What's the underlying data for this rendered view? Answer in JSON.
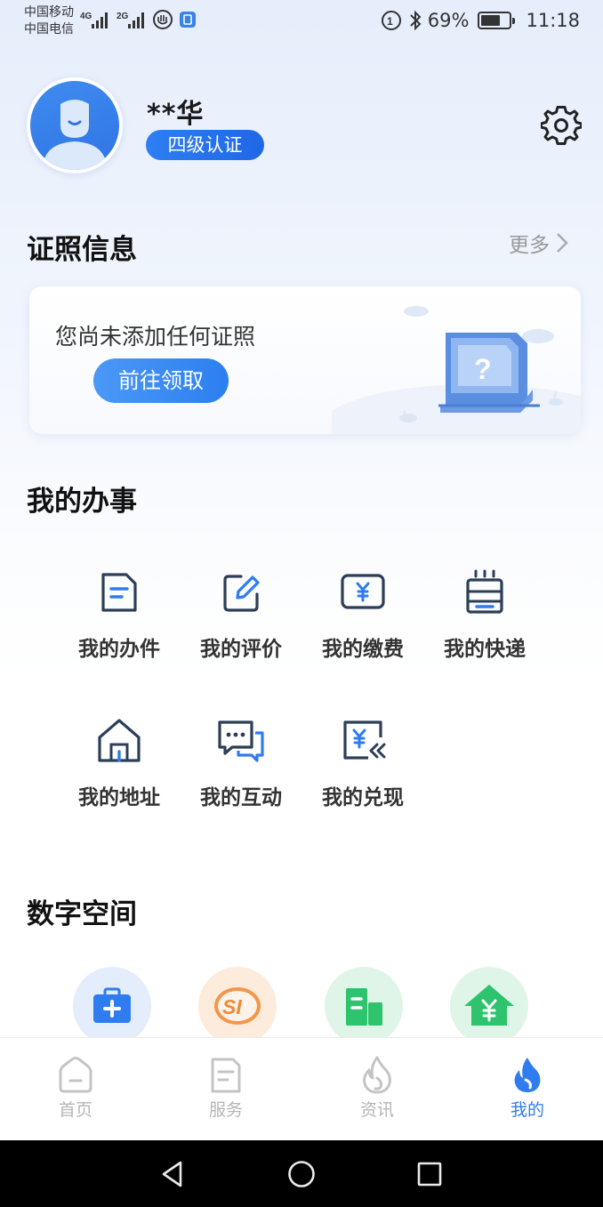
{
  "status_bar": {
    "carrier_1": "中国移动",
    "carrier_2": "中国电信",
    "net_1": "4G",
    "net_2": "2G",
    "battery_percent": "69%",
    "battery_level": 0.69,
    "time": "11:18"
  },
  "profile": {
    "username": "**华",
    "auth_level": "四级认证"
  },
  "license_section": {
    "title": "证照信息",
    "more_label": "更多",
    "empty_text": "您尚未添加任何证照",
    "claim_button": "前往领取"
  },
  "affairs_section": {
    "title": "我的办事",
    "items": [
      {
        "label": "我的办件",
        "icon": "document-icon"
      },
      {
        "label": "我的评价",
        "icon": "edit-icon"
      },
      {
        "label": "我的缴费",
        "icon": "payment-icon"
      },
      {
        "label": "我的快递",
        "icon": "package-icon"
      },
      {
        "label": "我的地址",
        "icon": "home-icon"
      },
      {
        "label": "我的互动",
        "icon": "chat-icon"
      },
      {
        "label": "我的兑现",
        "icon": "redeem-icon"
      }
    ]
  },
  "digital_section": {
    "title": "数字空间",
    "items": [
      {
        "icon": "medical-kit-icon",
        "bg": "#e3edfb",
        "fg": "#2f7cf0"
      },
      {
        "icon": "social-security-icon",
        "bg": "#fdebdc",
        "fg": "#f08a34"
      },
      {
        "icon": "building-icon",
        "bg": "#dff5e7",
        "fg": "#27c06a"
      },
      {
        "icon": "housing-fund-icon",
        "bg": "#dff5e7",
        "fg": "#27c06a"
      }
    ]
  },
  "bottom_nav": {
    "items": [
      {
        "label": "首页",
        "icon": "home-tab-icon"
      },
      {
        "label": "服务",
        "icon": "service-tab-icon"
      },
      {
        "label": "资讯",
        "icon": "news-tab-icon"
      },
      {
        "label": "我的",
        "icon": "mine-tab-icon"
      }
    ],
    "active_index": 3
  },
  "colors": {
    "accent": "#2f7cf0",
    "text_primary": "#111111",
    "text_secondary": "#999999",
    "inactive": "#b6b6b6"
  }
}
